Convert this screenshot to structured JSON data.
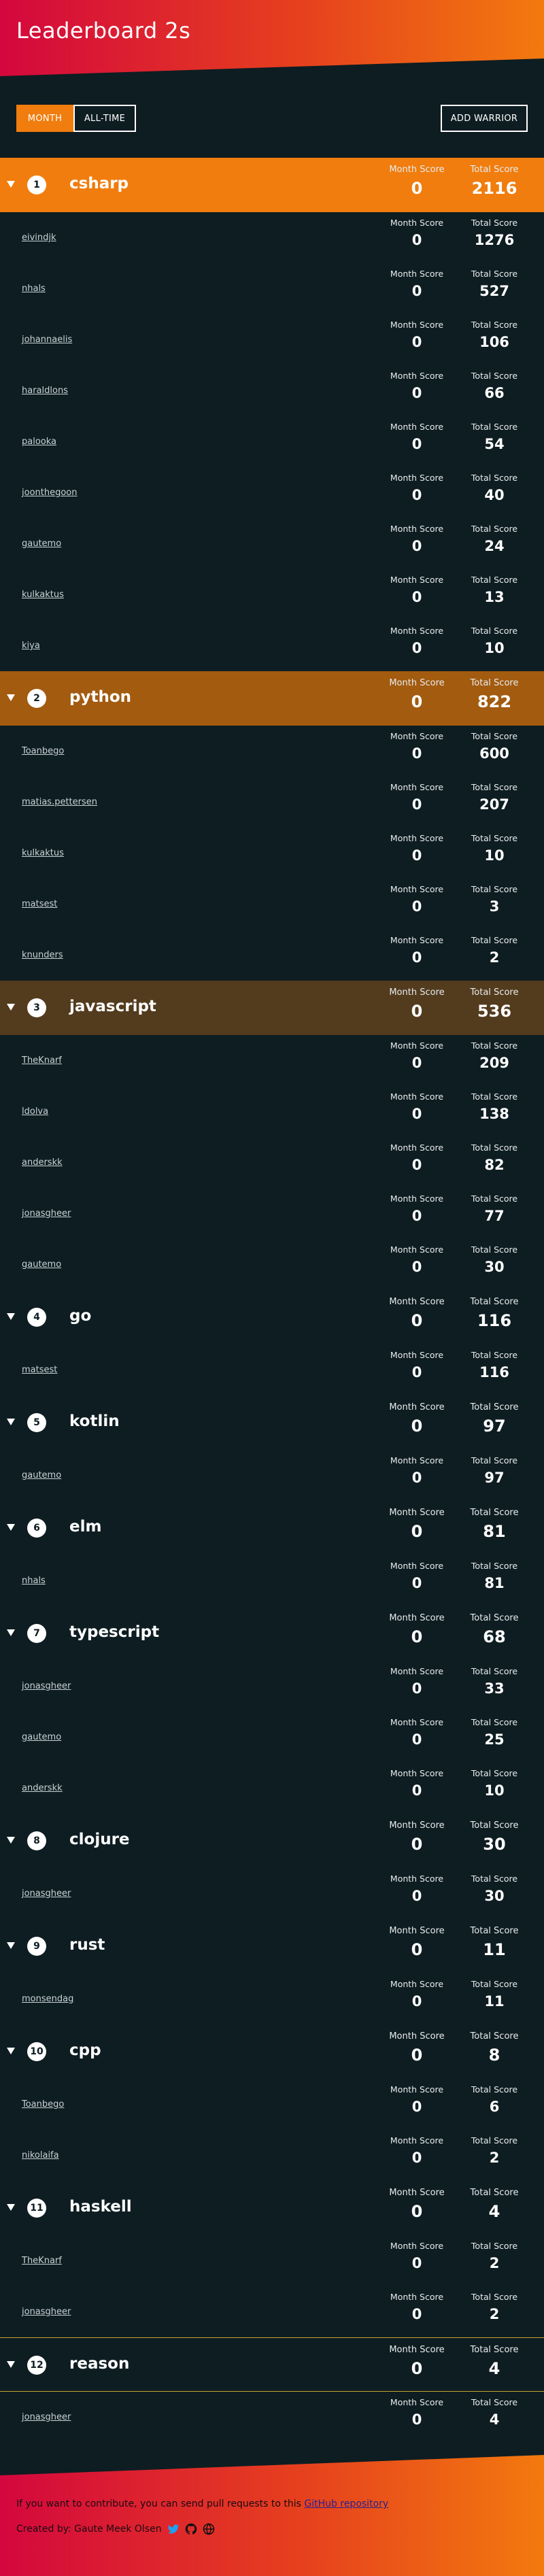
{
  "header": {
    "title": "Leaderboard 2s"
  },
  "controls": {
    "month": "MONTH",
    "all_time": "ALL-TIME",
    "add": "ADD WARRIOR"
  },
  "labels": {
    "month_score": "Month Score",
    "total_score": "Total Score"
  },
  "languages": [
    {
      "rank": "1",
      "name": "csharp",
      "month": "0",
      "total": "2116",
      "users": [
        {
          "name": "eivindjk",
          "month": "0",
          "total": "1276"
        },
        {
          "name": "nhals",
          "month": "0",
          "total": "527"
        },
        {
          "name": "johannaelis",
          "month": "0",
          "total": "106"
        },
        {
          "name": "haraldlons",
          "month": "0",
          "total": "66"
        },
        {
          "name": "palooka",
          "month": "0",
          "total": "54"
        },
        {
          "name": "joonthegoon",
          "month": "0",
          "total": "40"
        },
        {
          "name": "gautemo",
          "month": "0",
          "total": "24"
        },
        {
          "name": "kulkaktus",
          "month": "0",
          "total": "13"
        },
        {
          "name": "kiya",
          "month": "0",
          "total": "10"
        }
      ]
    },
    {
      "rank": "2",
      "name": "python",
      "month": "0",
      "total": "822",
      "users": [
        {
          "name": "Toanbego",
          "month": "0",
          "total": "600"
        },
        {
          "name": "matias.pettersen",
          "month": "0",
          "total": "207"
        },
        {
          "name": "kulkaktus",
          "month": "0",
          "total": "10"
        },
        {
          "name": "matsest",
          "month": "0",
          "total": "3"
        },
        {
          "name": "knunders",
          "month": "0",
          "total": "2"
        }
      ]
    },
    {
      "rank": "3",
      "name": "javascript",
      "month": "0",
      "total": "536",
      "users": [
        {
          "name": "TheKnarf",
          "month": "0",
          "total": "209"
        },
        {
          "name": "ldolva",
          "month": "0",
          "total": "138"
        },
        {
          "name": "anderskk",
          "month": "0",
          "total": "82"
        },
        {
          "name": "jonasgheer",
          "month": "0",
          "total": "77"
        },
        {
          "name": "gautemo",
          "month": "0",
          "total": "30"
        }
      ]
    },
    {
      "rank": "4",
      "name": "go",
      "month": "0",
      "total": "116",
      "users": [
        {
          "name": "matsest",
          "month": "0",
          "total": "116"
        }
      ]
    },
    {
      "rank": "5",
      "name": "kotlin",
      "month": "0",
      "total": "97",
      "users": [
        {
          "name": "gautemo",
          "month": "0",
          "total": "97"
        }
      ]
    },
    {
      "rank": "6",
      "name": "elm",
      "month": "0",
      "total": "81",
      "users": [
        {
          "name": "nhals",
          "month": "0",
          "total": "81"
        }
      ]
    },
    {
      "rank": "7",
      "name": "typescript",
      "month": "0",
      "total": "68",
      "users": [
        {
          "name": "jonasgheer",
          "month": "0",
          "total": "33"
        },
        {
          "name": "gautemo",
          "month": "0",
          "total": "25"
        },
        {
          "name": "anderskk",
          "month": "0",
          "total": "10"
        }
      ]
    },
    {
      "rank": "8",
      "name": "clojure",
      "month": "0",
      "total": "30",
      "users": [
        {
          "name": "jonasgheer",
          "month": "0",
          "total": "30"
        }
      ]
    },
    {
      "rank": "9",
      "name": "rust",
      "month": "0",
      "total": "11",
      "users": [
        {
          "name": "monsendag",
          "month": "0",
          "total": "11"
        }
      ]
    },
    {
      "rank": "10",
      "name": "cpp",
      "month": "0",
      "total": "8",
      "users": [
        {
          "name": "Toanbego",
          "month": "0",
          "total": "6"
        },
        {
          "name": "nikolaifa",
          "month": "0",
          "total": "2"
        }
      ]
    },
    {
      "rank": "11",
      "name": "haskell",
      "month": "0",
      "total": "4",
      "users": [
        {
          "name": "TheKnarf",
          "month": "0",
          "total": "2"
        },
        {
          "name": "jonasgheer",
          "month": "0",
          "total": "2"
        }
      ]
    },
    {
      "rank": "12",
      "name": "reason",
      "month": "0",
      "total": "4",
      "users": [
        {
          "name": "jonasgheer",
          "month": "0",
          "total": "4"
        }
      ]
    }
  ],
  "footer": {
    "contribute_text": "If you want to contribute, you can send pull requests to this ",
    "repo_link": "GitHub repository",
    "created_by": "Created by: Gaute Meek Olsen"
  },
  "colors": {
    "accent": "#f07d0e",
    "background": "#0e1d22",
    "gradient_start": "#d4073e"
  }
}
